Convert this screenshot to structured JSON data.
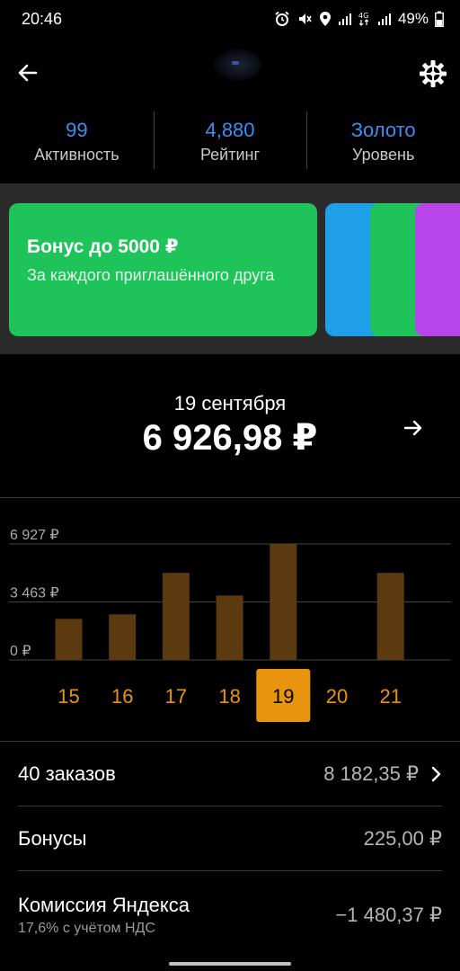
{
  "status_bar": {
    "time": "20:46",
    "battery": "49%",
    "icons": [
      "alarm-icon",
      "mute-icon",
      "location-icon",
      "signal-icon",
      "4g-icon",
      "signal-icon",
      "battery-icon"
    ]
  },
  "header": {
    "back_icon": "arrow-left-icon",
    "settings_icon": "gear-icon"
  },
  "stats": [
    {
      "value": "99",
      "label": "Активность"
    },
    {
      "value": "4,880",
      "label": "Рейтинг"
    },
    {
      "value": "Золото",
      "label": "Уровень"
    }
  ],
  "promo": {
    "title": "Бонус до 5000 ₽",
    "subtitle": "За каждого приглашённого друга",
    "colors": [
      "#1ec45a",
      "#1e9fe8",
      "#1ec45a",
      "#b845ea"
    ]
  },
  "earnings": {
    "date": "19 сентября",
    "amount": "6 926,98 ₽",
    "next_icon": "arrow-right-icon"
  },
  "chart_data": {
    "type": "bar",
    "categories": [
      "15",
      "16",
      "17",
      "18",
      "19",
      "20",
      "21"
    ],
    "values": [
      2450,
      2720,
      5200,
      3850,
      6927,
      0,
      5200
    ],
    "ylim": [
      0,
      6927
    ],
    "y_ticks": [
      {
        "value": 6927,
        "label": "6 927 ₽"
      },
      {
        "value": 3463,
        "label": "3 463 ₽"
      },
      {
        "value": 0,
        "label": "0 ₽"
      }
    ],
    "selected": "19",
    "bar_color": "#5a3a0e",
    "accent_color": "#e8940f",
    "grid": true
  },
  "summary": {
    "orders": {
      "label": "40 заказов",
      "value": "8 182,35 ₽"
    },
    "bonuses": {
      "label": "Бонусы",
      "value": "225,00 ₽"
    },
    "commission": {
      "label": "Комиссия Яндекса",
      "sublabel": "17,6% с учётом НДС",
      "value": "−1 480,37 ₽"
    }
  }
}
